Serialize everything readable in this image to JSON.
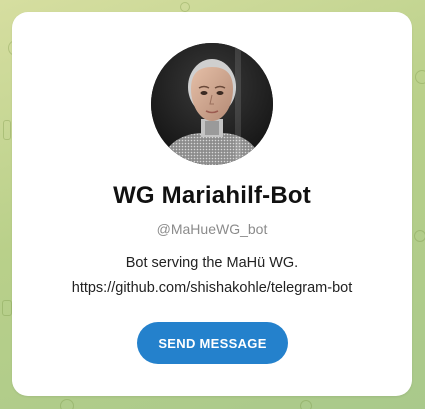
{
  "profile": {
    "name": "WG Mariahilf-Bot",
    "username": "@MaHueWG_bot",
    "description_lines": [
      "Bot serving the MaHü WG.",
      "https://github.com/shishakohle/telegram-bot"
    ]
  },
  "actions": {
    "send_message_label": "SEND MESSAGE"
  },
  "icons": {
    "avatar": "avatar-photo"
  },
  "colors": {
    "accent": "#2481cc",
    "background_start": "#d6dea0",
    "background_end": "#a9c98b",
    "card": "#ffffff",
    "username": "#8b8b8b"
  }
}
